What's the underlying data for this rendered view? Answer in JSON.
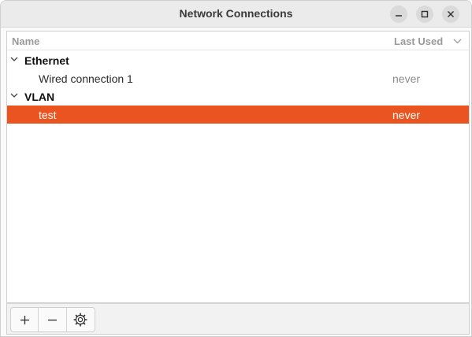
{
  "window": {
    "title": "Network Connections",
    "controls": [
      "minimize-icon",
      "maximize-icon",
      "close-icon"
    ]
  },
  "columns": {
    "name": "Name",
    "last_used": "Last Used"
  },
  "groups": [
    {
      "label": "Ethernet",
      "expanded": true,
      "items": [
        {
          "label": "Wired connection 1",
          "last_used": "never",
          "selected": false
        }
      ]
    },
    {
      "label": "VLAN",
      "expanded": true,
      "items": [
        {
          "label": "test",
          "last_used": "never",
          "selected": true
        }
      ]
    }
  ],
  "toolbar": {
    "buttons": [
      "add-icon",
      "remove-icon",
      "settings-icon"
    ]
  },
  "colors": {
    "selection": "#e95420",
    "header_text": "#9a9a9a"
  }
}
